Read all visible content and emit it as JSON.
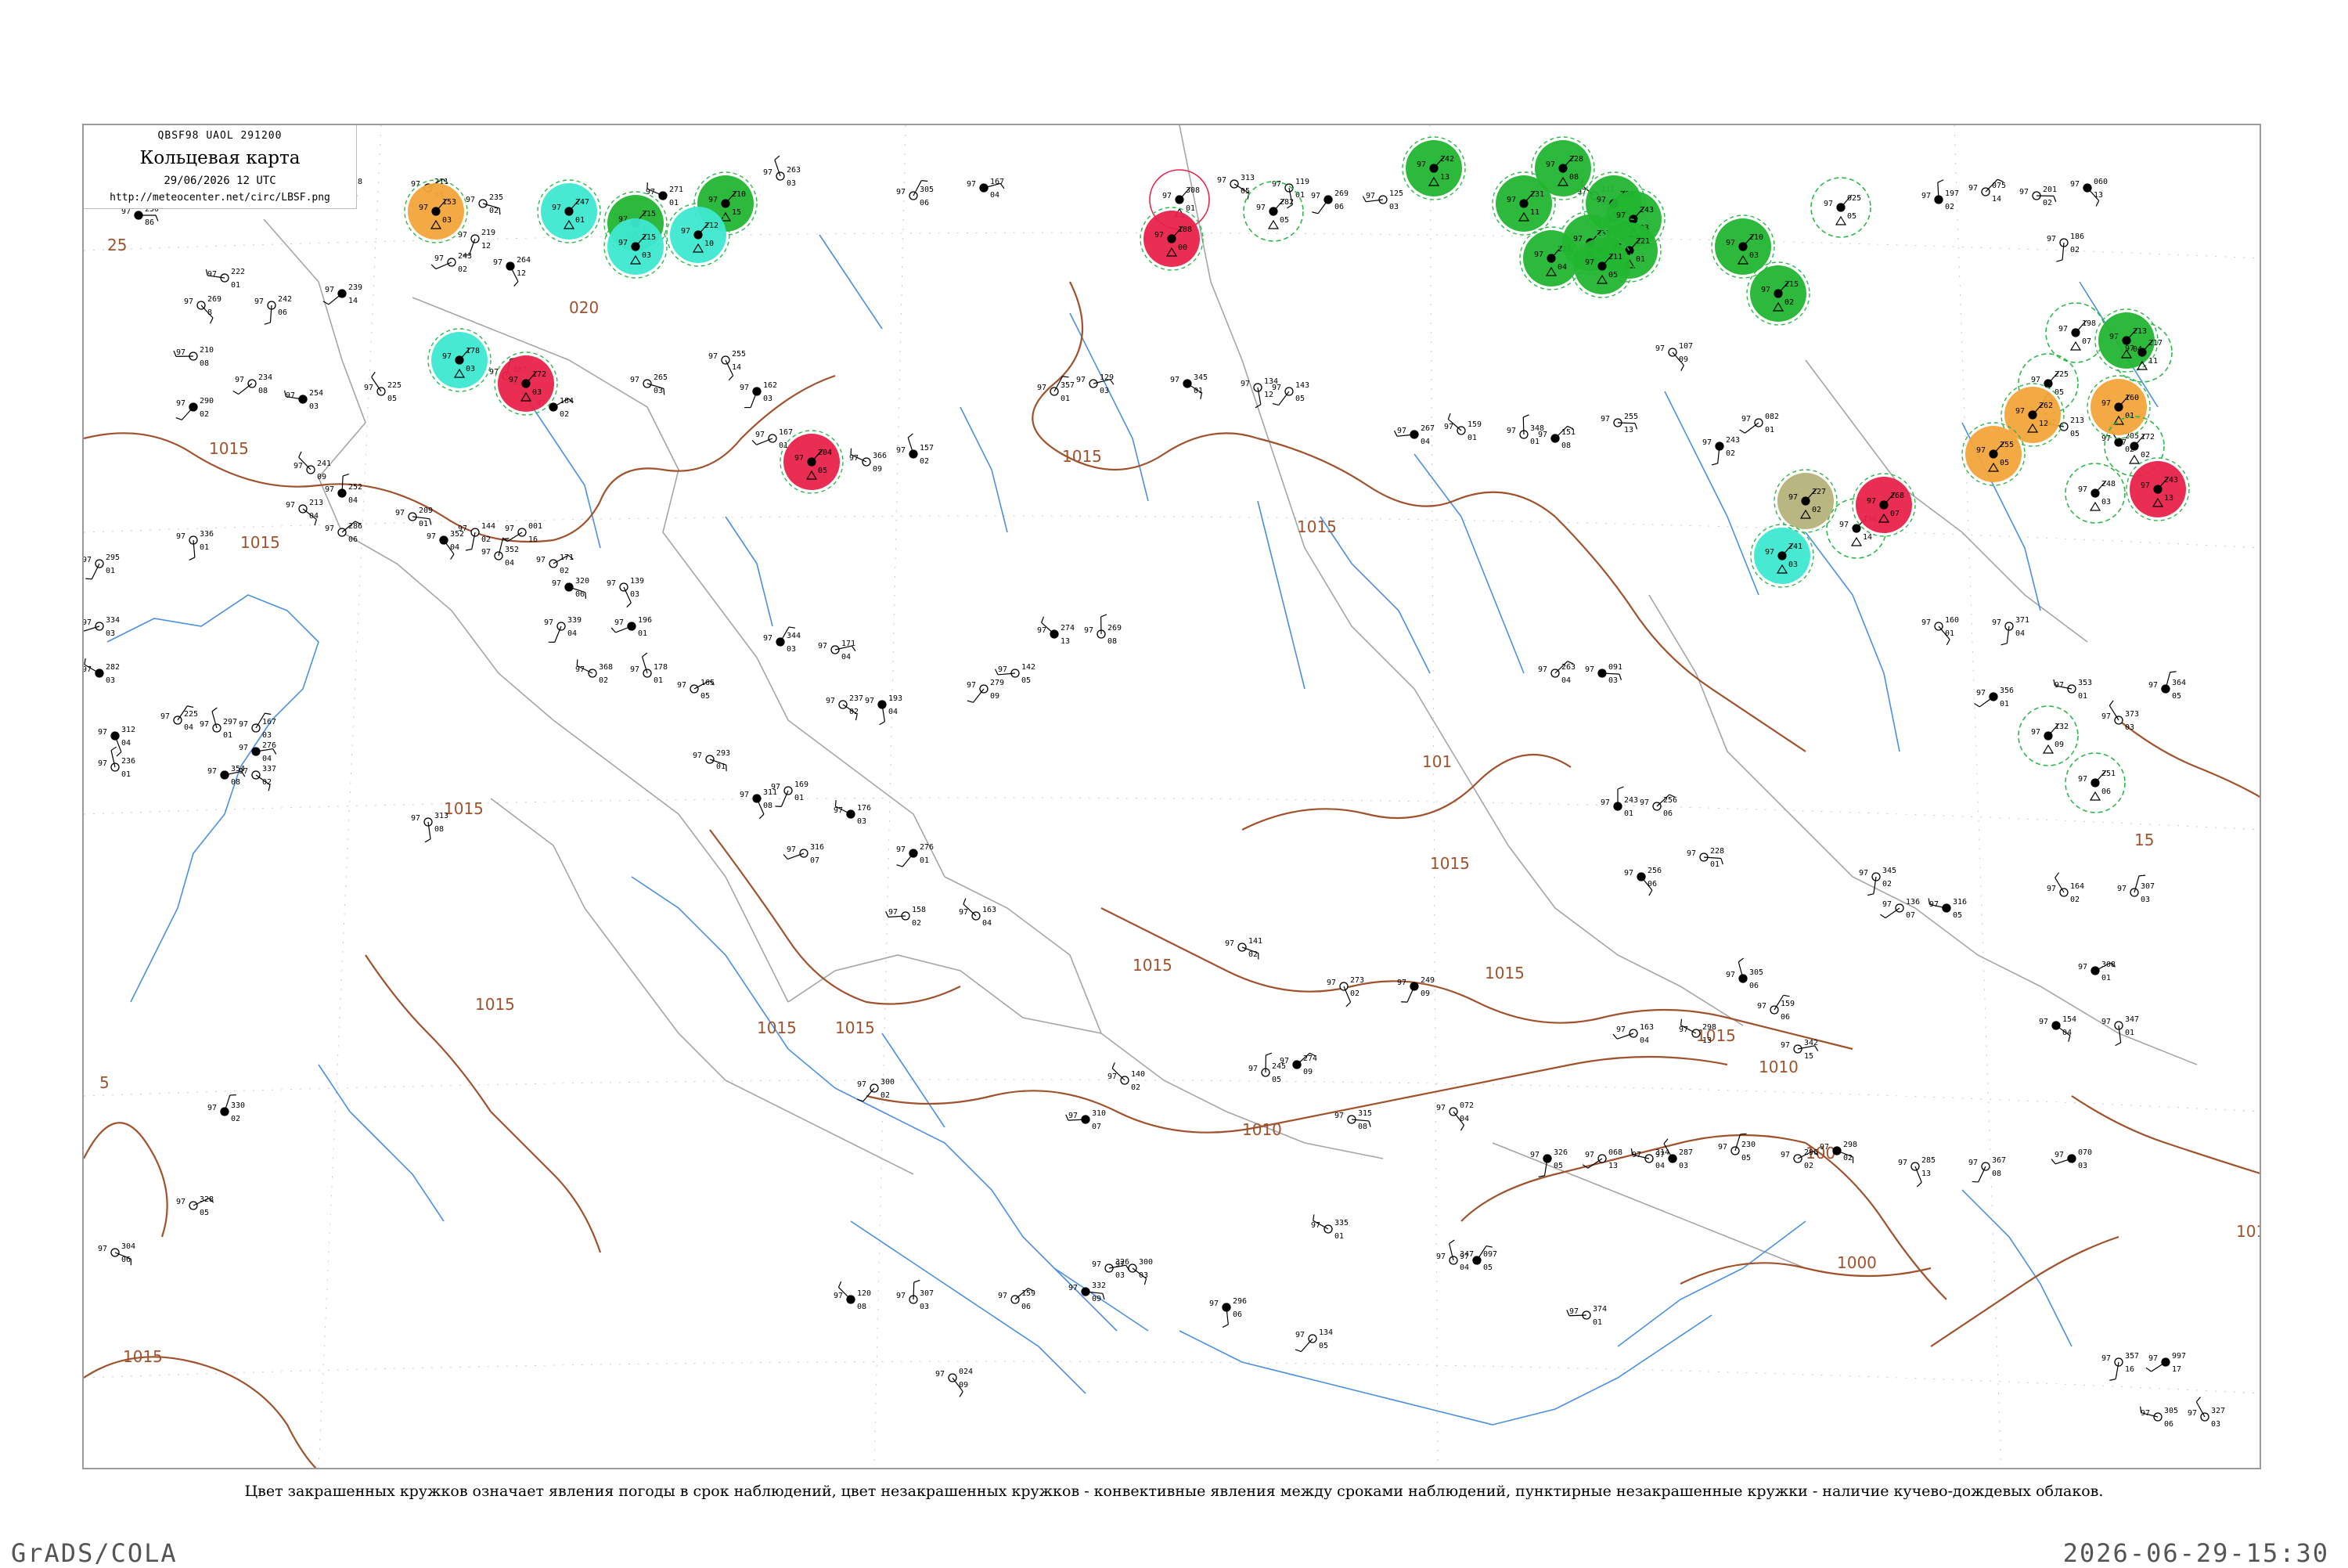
{
  "title_box": {
    "header": "QBSF98  UAOL  291200",
    "title": "Кольцевая карта",
    "date": "29/06/2026 12 UTC",
    "url": "http://meteocenter.net/circ/LBSF.png"
  },
  "caption": "Цвет закрашенных кружков означает явления погоды в срок наблюдений, цвет незакрашенных кружков - конвективные явления между сроками наблюдений, пунктирные незакрашенные кружки - наличие кучево-дождевых облаков.",
  "software": "GrADS/COLA",
  "timestamp": "2026-06-29-15:30",
  "colors": {
    "isobar": "#a0522d",
    "coast": "#4a90e2",
    "border": "#a0a0a0",
    "thunder_green": "#22b530",
    "rain_red": "#e8224a",
    "showers_cyan": "#3ee8d0",
    "orange": "#f2a53a",
    "olive": "#b5b27a",
    "cb_dashed": "#2fb84a"
  },
  "isobar_labels": [
    {
      "text": "25"
    },
    {
      "text": "1015"
    },
    {
      "text": "1015"
    },
    {
      "text": "1015"
    },
    {
      "text": "1015"
    },
    {
      "text": "1015"
    },
    {
      "text": "1015"
    },
    {
      "text": "1015"
    },
    {
      "text": "1015"
    },
    {
      "text": "1015"
    },
    {
      "text": "1015"
    },
    {
      "text": "1015"
    },
    {
      "text": "1015"
    },
    {
      "text": "1010"
    },
    {
      "text": "1010"
    },
    {
      "text": "100"
    },
    {
      "text": "1000"
    },
    {
      "text": "101"
    },
    {
      "text": "1015"
    },
    {
      "text": "15"
    },
    {
      "text": "5"
    },
    {
      "text": "101"
    },
    {
      "text": "020"
    }
  ],
  "stations": [
    {
      "p": "250",
      "t": "97",
      "d": "86"
    },
    {
      "p": "269",
      "t": "97",
      "d": "8"
    },
    {
      "p": "242",
      "t": "97",
      "d": "06"
    },
    {
      "p": "239",
      "t": "97",
      "d": "14"
    },
    {
      "p": "222",
      "t": "97",
      "d": "01"
    },
    {
      "p": "228",
      "t": "97",
      "d": "03"
    },
    {
      "p": "240",
      "t": "97",
      "d": "14"
    },
    {
      "p": "211",
      "t": "97",
      "d": "03"
    },
    {
      "p": "235",
      "t": "97",
      "d": "02"
    },
    {
      "p": "264",
      "t": "97",
      "d": "12"
    },
    {
      "p": "219",
      "t": "97",
      "d": "12"
    },
    {
      "p": "243",
      "t": "97",
      "d": "02"
    },
    {
      "p": "271",
      "t": "97",
      "d": "01"
    },
    {
      "p": "263",
      "t": "97",
      "d": "03"
    },
    {
      "p": "305",
      "t": "97",
      "d": "06"
    },
    {
      "p": "167",
      "t": "97",
      "d": "04"
    },
    {
      "p": "313",
      "t": "97",
      "d": "05"
    },
    {
      "p": "119",
      "t": "97",
      "d": "01"
    },
    {
      "p": "269",
      "t": "97",
      "d": "06"
    },
    {
      "p": "125",
      "t": "97",
      "d": "03"
    },
    {
      "p": "131",
      "t": "97",
      "d": "05"
    },
    {
      "p": "197",
      "t": "97",
      "d": "02"
    },
    {
      "p": "075",
      "t": "97",
      "d": "14"
    },
    {
      "p": "201",
      "t": "97",
      "d": "02"
    },
    {
      "p": "060",
      "t": "97",
      "d": "13"
    },
    {
      "p": "186",
      "t": "97",
      "d": "02"
    },
    {
      "p": "234",
      "t": "97",
      "d": "08"
    },
    {
      "p": "254",
      "t": "97",
      "d": "03"
    },
    {
      "p": "225",
      "t": "97",
      "d": "05"
    },
    {
      "p": "307",
      "t": "97",
      "d": "03"
    },
    {
      "p": "184",
      "t": "97",
      "d": "02"
    },
    {
      "p": "265",
      "t": "97",
      "d": "03"
    },
    {
      "p": "255",
      "t": "97",
      "d": "14"
    },
    {
      "p": "162",
      "t": "97",
      "d": "03"
    },
    {
      "p": "167",
      "t": "97",
      "d": "01"
    },
    {
      "p": "366",
      "t": "97",
      "d": "09"
    },
    {
      "p": "157",
      "t": "97",
      "d": "02"
    },
    {
      "p": "357",
      "t": "97",
      "d": "01"
    },
    {
      "p": "129",
      "t": "97",
      "d": "03"
    },
    {
      "p": "345",
      "t": "97",
      "d": "01"
    },
    {
      "p": "134",
      "t": "97",
      "d": "12"
    },
    {
      "p": "143",
      "t": "97",
      "d": "05"
    },
    {
      "p": "267",
      "t": "97",
      "d": "04"
    },
    {
      "p": "159",
      "t": "97",
      "d": "01"
    },
    {
      "p": "348",
      "t": "97",
      "d": "01"
    },
    {
      "p": "151",
      "t": "97",
      "d": "08"
    },
    {
      "p": "255",
      "t": "97",
      "d": "13"
    },
    {
      "p": "107",
      "t": "97",
      "d": "09"
    },
    {
      "p": "243",
      "t": "97",
      "d": "02"
    },
    {
      "p": "082",
      "t": "97",
      "d": "01"
    },
    {
      "p": "213",
      "t": "97",
      "d": "05"
    },
    {
      "p": "205",
      "t": "97",
      "d": "02"
    },
    {
      "p": "352",
      "t": "97",
      "d": "04"
    },
    {
      "p": "171",
      "t": "97",
      "d": "02"
    },
    {
      "p": "320",
      "t": "97",
      "d": "06"
    },
    {
      "p": "139",
      "t": "97",
      "d": "03"
    },
    {
      "p": "339",
      "t": "97",
      "d": "04"
    },
    {
      "p": "196",
      "t": "97",
      "d": "01"
    },
    {
      "p": "368",
      "t": "97",
      "d": "02"
    },
    {
      "p": "178",
      "t": "97",
      "d": "01"
    },
    {
      "p": "344",
      "t": "97",
      "d": "03"
    },
    {
      "p": "171",
      "t": "97",
      "d": "04"
    },
    {
      "p": "237",
      "t": "97",
      "d": "02"
    },
    {
      "p": "193",
      "t": "97",
      "d": "04"
    },
    {
      "p": "279",
      "t": "97",
      "d": "09"
    },
    {
      "p": "142",
      "t": "97",
      "d": "05"
    },
    {
      "p": "274",
      "t": "97",
      "d": "13"
    },
    {
      "p": "269",
      "t": "97",
      "d": "08"
    },
    {
      "p": "263",
      "t": "97",
      "d": "04"
    },
    {
      "p": "091",
      "t": "97",
      "d": "03"
    },
    {
      "p": "160",
      "t": "97",
      "d": "01"
    },
    {
      "p": "371",
      "t": "97",
      "d": "04"
    },
    {
      "p": "356",
      "t": "97",
      "d": "01"
    },
    {
      "p": "353",
      "t": "97",
      "d": "01"
    },
    {
      "p": "373",
      "t": "97",
      "d": "03"
    },
    {
      "p": "364",
      "t": "97",
      "d": "05"
    },
    {
      "p": "165",
      "t": "97",
      "d": "05"
    },
    {
      "p": "293",
      "t": "97",
      "d": "01"
    },
    {
      "p": "311",
      "t": "97",
      "d": "08"
    },
    {
      "p": "169",
      "t": "97",
      "d": "01"
    },
    {
      "p": "316",
      "t": "97",
      "d": "07"
    },
    {
      "p": "176",
      "t": "97",
      "d": "03"
    },
    {
      "p": "297",
      "t": "97",
      "d": "01"
    },
    {
      "p": "167",
      "t": "97",
      "d": "03"
    },
    {
      "p": "354",
      "t": "97",
      "d": "08"
    },
    {
      "p": "337",
      "t": "97",
      "d": "02"
    },
    {
      "p": "313",
      "t": "97",
      "d": "08"
    },
    {
      "p": "276",
      "t": "97",
      "d": "01"
    },
    {
      "p": "158",
      "t": "97",
      "d": "02"
    },
    {
      "p": "163",
      "t": "97",
      "d": "04"
    },
    {
      "p": "243",
      "t": "97",
      "d": "01"
    },
    {
      "p": "256",
      "t": "97",
      "d": "06"
    },
    {
      "p": "228",
      "t": "97",
      "d": "01"
    },
    {
      "p": "256",
      "t": "97",
      "d": "06"
    },
    {
      "p": "345",
      "t": "97",
      "d": "02"
    },
    {
      "p": "136",
      "t": "97",
      "d": "07"
    },
    {
      "p": "316",
      "t": "97",
      "d": "05"
    },
    {
      "p": "164",
      "t": "97",
      "d": "02"
    },
    {
      "p": "307",
      "t": "97",
      "d": "03"
    },
    {
      "p": "308",
      "t": "97",
      "d": "01"
    },
    {
      "p": "141",
      "t": "97",
      "d": "02"
    },
    {
      "p": "273",
      "t": "97",
      "d": "02"
    },
    {
      "p": "249",
      "t": "97",
      "d": "09"
    },
    {
      "p": "163",
      "t": "97",
      "d": "04"
    },
    {
      "p": "298",
      "t": "97",
      "d": "13"
    },
    {
      "p": "305",
      "t": "97",
      "d": "06"
    },
    {
      "p": "159",
      "t": "97",
      "d": "06"
    },
    {
      "p": "342",
      "t": "97",
      "d": "15"
    },
    {
      "p": "154",
      "t": "97",
      "d": "04"
    },
    {
      "p": "347",
      "t": "97",
      "d": "01"
    },
    {
      "p": "300",
      "t": "97",
      "d": "02"
    },
    {
      "p": "310",
      "t": "97",
      "d": "07"
    },
    {
      "p": "140",
      "t": "97",
      "d": "02"
    },
    {
      "p": "245",
      "t": "97",
      "d": "05"
    },
    {
      "p": "274",
      "t": "97",
      "d": "09"
    },
    {
      "p": "315",
      "t": "97",
      "d": "08"
    },
    {
      "p": "072",
      "t": "97",
      "d": "04"
    },
    {
      "p": "326",
      "t": "97",
      "d": "05"
    },
    {
      "p": "068",
      "t": "97",
      "d": "13"
    },
    {
      "p": "314",
      "t": "97",
      "d": "04"
    },
    {
      "p": "287",
      "t": "97",
      "d": "03"
    },
    {
      "p": "230",
      "t": "97",
      "d": "05"
    },
    {
      "p": "296",
      "t": "97",
      "d": "02"
    },
    {
      "p": "298",
      "t": "97",
      "d": "02"
    },
    {
      "p": "285",
      "t": "97",
      "d": "13"
    },
    {
      "p": "367",
      "t": "97",
      "d": "08"
    },
    {
      "p": "070",
      "t": "97",
      "d": "03"
    },
    {
      "p": "335",
      "t": "97",
      "d": "01"
    },
    {
      "p": "347",
      "t": "97",
      "d": "04"
    },
    {
      "p": "097",
      "t": "97",
      "d": "05"
    },
    {
      "p": "326",
      "t": "97",
      "d": "03"
    },
    {
      "p": "300",
      "t": "97",
      "d": "03"
    },
    {
      "p": "296",
      "t": "97",
      "d": "06"
    },
    {
      "p": "134",
      "t": "97",
      "d": "05"
    },
    {
      "p": "374",
      "t": "97",
      "d": "01"
    },
    {
      "p": "120",
      "t": "97",
      "d": "08"
    },
    {
      "p": "307",
      "t": "97",
      "d": "03"
    },
    {
      "p": "159",
      "t": "97",
      "d": "06"
    },
    {
      "p": "332",
      "t": "97",
      "d": "09"
    },
    {
      "p": "024",
      "t": "97",
      "d": "09"
    },
    {
      "p": "357",
      "t": "97",
      "d": "16"
    },
    {
      "p": "997",
      "t": "97",
      "d": "17"
    },
    {
      "p": "305",
      "t": "97",
      "d": "06"
    },
    {
      "p": "327",
      "t": "97",
      "d": "03"
    },
    {
      "p": "330",
      "t": "97",
      "d": "02"
    },
    {
      "p": "328",
      "t": "97",
      "d": "05"
    },
    {
      "p": "304",
      "t": "97",
      "d": "06"
    },
    {
      "p": "312",
      "t": "97",
      "d": "04"
    },
    {
      "p": "295",
      "t": "97",
      "d": "01"
    },
    {
      "p": "334",
      "t": "97",
      "d": "03"
    },
    {
      "p": "282",
      "t": "97",
      "d": "03"
    },
    {
      "p": "236",
      "t": "97",
      "d": "01"
    },
    {
      "p": "225",
      "t": "97",
      "d": "04"
    },
    {
      "p": "276",
      "t": "97",
      "d": "04"
    },
    {
      "p": "213",
      "t": "97",
      "d": "04"
    },
    {
      "p": "336",
      "t": "97",
      "d": "01"
    },
    {
      "p": "290",
      "t": "97",
      "d": "02"
    },
    {
      "p": "210",
      "t": "97",
      "d": "08"
    },
    {
      "p": "241",
      "t": "97",
      "d": "09"
    },
    {
      "p": "252",
      "t": "97",
      "d": "04"
    },
    {
      "p": "286",
      "t": "97",
      "d": "06"
    },
    {
      "p": "209",
      "t": "97",
      "d": "01"
    },
    {
      "p": "352",
      "t": "97",
      "d": "04"
    },
    {
      "p": "144",
      "t": "97",
      "d": "02"
    },
    {
      "p": "001",
      "t": "97",
      "d": "16"
    }
  ],
  "circles": [
    {
      "p": "153",
      "t": "97",
      "d": "03"
    },
    {
      "p": "247",
      "t": "97",
      "d": "01"
    },
    {
      "p": "215",
      "t": "97",
      "d": "12"
    },
    {
      "p": "210",
      "t": "97",
      "d": "15"
    },
    {
      "p": "212",
      "t": "97",
      "d": "10"
    },
    {
      "p": "215",
      "t": "97",
      "d": "03"
    },
    {
      "p": "178",
      "t": "97",
      "d": "03"
    },
    {
      "p": "172",
      "t": "97",
      "d": "03"
    },
    {
      "p": "204",
      "t": "97",
      "d": "05"
    },
    {
      "p": "308",
      "t": "97",
      "d": "01"
    },
    {
      "p": "188",
      "t": "97",
      "d": "00"
    },
    {
      "p": "282",
      "t": "97",
      "d": "05"
    },
    {
      "p": "242",
      "t": "97",
      "d": "13"
    },
    {
      "p": "228",
      "t": "97",
      "d": "08"
    },
    {
      "p": "231",
      "t": "97",
      "d": "11"
    },
    {
      "p": "208",
      "t": "97",
      "d": "14"
    },
    {
      "p": "211",
      "t": "97",
      "d": "04"
    },
    {
      "p": "233",
      "t": "97",
      "d": "03"
    },
    {
      "p": "243",
      "t": "97",
      "d": "03"
    },
    {
      "p": "221",
      "t": "97",
      "d": "01"
    },
    {
      "p": "211",
      "t": "97",
      "d": "05"
    },
    {
      "p": "210",
      "t": "97",
      "d": "03"
    },
    {
      "p": "215",
      "t": "97",
      "d": "02"
    },
    {
      "p": "025",
      "t": "97",
      "d": "05"
    },
    {
      "p": "213",
      "t": "97",
      "d": "04"
    },
    {
      "p": "217",
      "t": "97",
      "d": "11"
    },
    {
      "p": "198",
      "t": "97",
      "d": "07"
    },
    {
      "p": "225",
      "t": "97",
      "d": "05"
    },
    {
      "p": "262",
      "t": "97",
      "d": "12"
    },
    {
      "p": "255",
      "t": "97",
      "d": "05"
    },
    {
      "p": "160",
      "t": "97",
      "d": "01"
    },
    {
      "p": "172",
      "t": "97",
      "d": "02"
    },
    {
      "p": "248",
      "t": "97",
      "d": "03"
    },
    {
      "p": "243",
      "t": "97",
      "d": "13"
    },
    {
      "p": "136",
      "t": "97",
      "d": "14"
    },
    {
      "p": "227",
      "t": "97",
      "d": "02"
    },
    {
      "p": "268",
      "t": "97",
      "d": "07"
    },
    {
      "p": "241",
      "t": "97",
      "d": "03"
    },
    {
      "p": "132",
      "t": "97",
      "d": "09"
    },
    {
      "p": "251",
      "t": "97",
      "d": "06"
    }
  ]
}
